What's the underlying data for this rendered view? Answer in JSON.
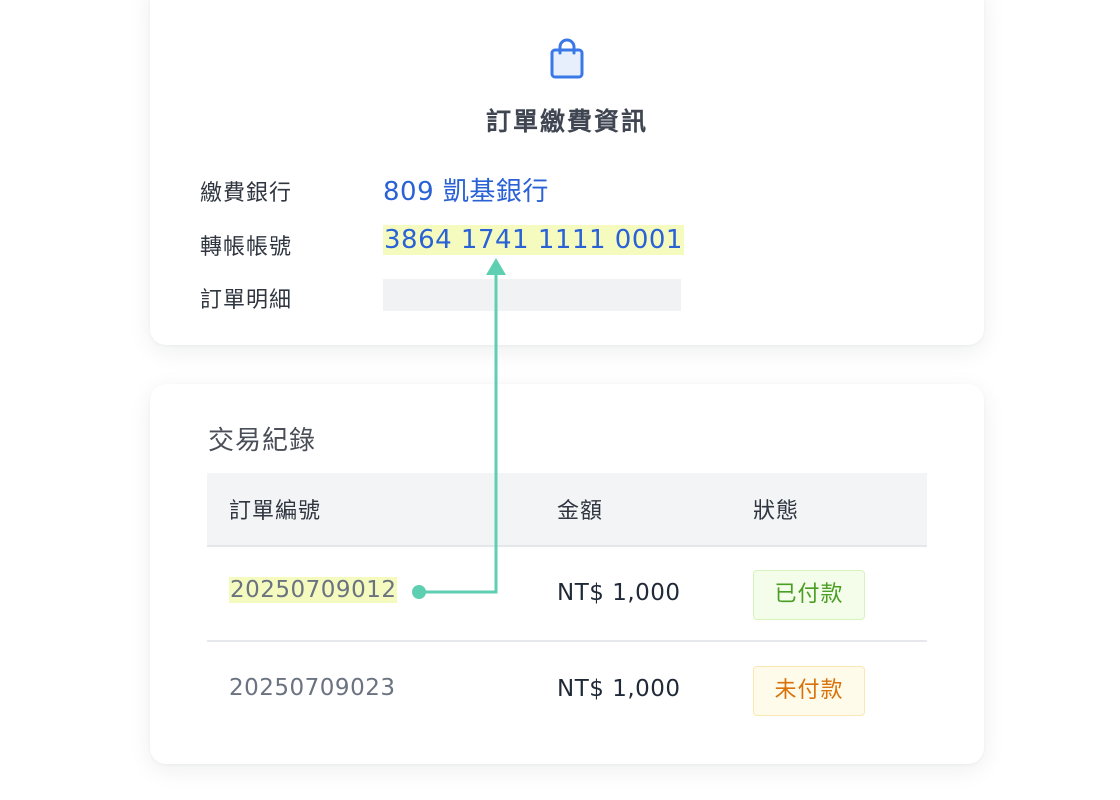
{
  "payment_card": {
    "icon": "shopping-bag-icon",
    "title": "訂單繳費資訊",
    "bank_label": "繳費銀行",
    "bank_value": "809 凱基銀行",
    "account_label": "轉帳帳號",
    "account_value": "3864 1741 1111 0001",
    "detail_label": "訂單明細",
    "detail_value": ""
  },
  "transactions": {
    "title": "交易紀錄",
    "columns": [
      "訂單編號",
      "金額",
      "狀態"
    ],
    "rows": [
      {
        "order_id": "20250709012",
        "amount": "NT$ 1,000",
        "status": "已付款"
      },
      {
        "order_id": "20250709023",
        "amount": "NT$ 1,000",
        "status": "未付款"
      }
    ]
  },
  "colors": {
    "accent_blue": "#2a62d6",
    "highlight": "#f5fbbf",
    "connector": "#5ecfb1",
    "paid": "#4b9e24",
    "unpaid": "#d9720b"
  }
}
